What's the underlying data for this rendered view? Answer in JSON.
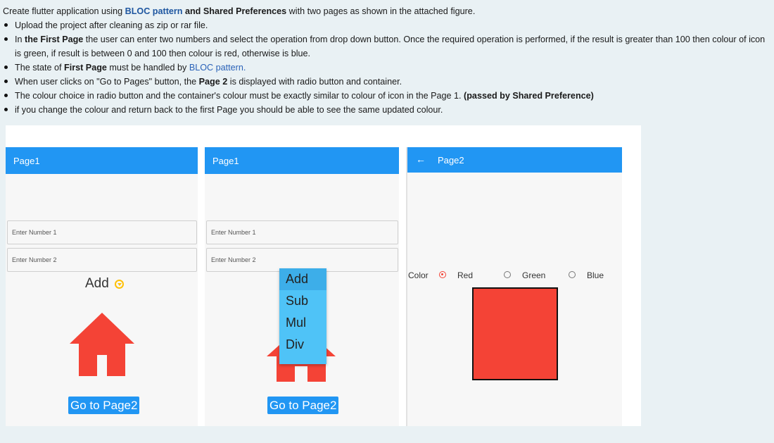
{
  "instructions": {
    "intro_pre": "Create flutter application using ",
    "intro_bloc": "BLOC pattern",
    "intro_and": " and ",
    "intro_shared": "Shared Preferences",
    "intro_post": " with two pages as shown in the attached figure.",
    "b1": "Upload the project after cleaning as zip or rar file.",
    "b2_pre": "In ",
    "b2_bold": "the First Page",
    "b2_post": " the user can enter two numbers and select the operation from drop down button. Once the required operation is performed, if the result is greater than 100 then colour of icon is green, if result is between 0 and 100 then colour is red, otherwise is blue.",
    "b3_pre": "The state of ",
    "b3_bold": "First Page",
    "b3_mid": " must be handled by ",
    "b3_link": "BLOC pattern.",
    "b4_pre": "When user clicks on \"Go to Pages\" button, the ",
    "b4_bold": "Page 2",
    "b4_post": " is displayed with radio button and container.",
    "b5_pre": "The colour choice in radio button and the container's colour must be exactly similar to colour of icon in the Page 1. ",
    "b5_bold": "(passed by Shared Preference)",
    "b6": "if you change the colour and return back to the first Page you should be able to see the same updated colour."
  },
  "screen1": {
    "title": "Page1",
    "field1_placeholder": "Enter Number 1",
    "field2_placeholder": "Enter Number 2",
    "operation": "Add",
    "icon": "home-icon",
    "icon_color": "#f44336",
    "button_label": "Go to Page2"
  },
  "screen2": {
    "title": "Page1",
    "field1_placeholder": "Enter Number 1",
    "field2_placeholder": "Enter Number 2",
    "dropdown_options": [
      "Add",
      "Sub",
      "Mul",
      "Div"
    ],
    "selected_option": "Add",
    "button_label": "Go to Page2"
  },
  "screen3": {
    "title": "Page2",
    "color_label": "Color",
    "options": [
      "Red",
      "Green",
      "Blue"
    ],
    "selected": "Red",
    "container_color": "#f44336"
  },
  "colors": {
    "appbar": "#2196f3",
    "dropdown": "#4fc3f7",
    "accent": "#ffc107"
  }
}
